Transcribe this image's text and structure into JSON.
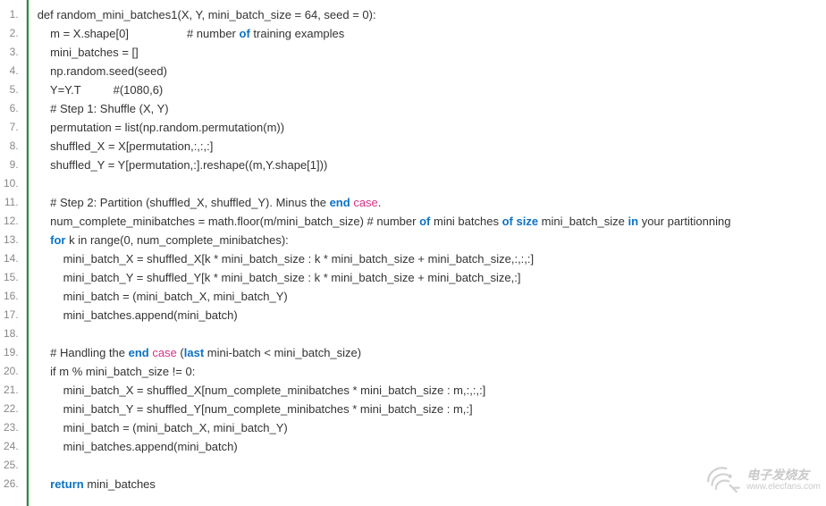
{
  "watermark": {
    "cn": "电子发烧友",
    "en": "www.elecfans.com"
  },
  "lines": [
    {
      "num": "1.",
      "segs": [
        {
          "t": "def random_mini_batches1(X, Y, mini_batch_size = 64, seed = 0):"
        }
      ],
      "indent": 0
    },
    {
      "num": "2.",
      "segs": [
        {
          "t": "m = X.shape[0]                  # number "
        },
        {
          "t": "of",
          "c": "kw-blue"
        },
        {
          "t": " training examples"
        }
      ],
      "indent": 1
    },
    {
      "num": "3.",
      "segs": [
        {
          "t": "mini_batches = []"
        }
      ],
      "indent": 1
    },
    {
      "num": "4.",
      "segs": [
        {
          "t": "np.random.seed(seed)"
        }
      ],
      "indent": 1
    },
    {
      "num": "5.",
      "segs": [
        {
          "t": "Y=Y.T          #(1080,6)"
        }
      ],
      "indent": 1
    },
    {
      "num": "6.",
      "segs": [
        {
          "t": "# Step 1: Shuffle (X, Y)"
        }
      ],
      "indent": 1
    },
    {
      "num": "7.",
      "segs": [
        {
          "t": "permutation = list(np.random.permutation(m))"
        }
      ],
      "indent": 1
    },
    {
      "num": "8.",
      "segs": [
        {
          "t": "shuffled_X = X[permutation,:,:,:]"
        }
      ],
      "indent": 1
    },
    {
      "num": "9.",
      "segs": [
        {
          "t": "shuffled_Y = Y[permutation,:].reshape((m,Y.shape[1]))"
        }
      ],
      "indent": 1
    },
    {
      "num": "10.",
      "segs": [
        {
          "t": ""
        }
      ],
      "indent": 0
    },
    {
      "num": "11.",
      "segs": [
        {
          "t": "# Step 2: Partition (shuffled_X, shuffled_Y). Minus the "
        },
        {
          "t": "end",
          "c": "kw-blue"
        },
        {
          "t": " "
        },
        {
          "t": "case",
          "c": "kw-pink"
        },
        {
          "t": "."
        }
      ],
      "indent": 1
    },
    {
      "num": "12.",
      "segs": [
        {
          "t": "num_complete_minibatches = math.floor(m/mini_batch_size) # number "
        },
        {
          "t": "of",
          "c": "kw-blue"
        },
        {
          "t": " mini batches "
        },
        {
          "t": "of",
          "c": "kw-blue"
        },
        {
          "t": " "
        },
        {
          "t": "size",
          "c": "kw-blue"
        },
        {
          "t": " mini_batch_size "
        },
        {
          "t": "in",
          "c": "kw-blue"
        },
        {
          "t": " your partitionning"
        }
      ],
      "indent": 1
    },
    {
      "num": "13.",
      "segs": [
        {
          "t": "for",
          "c": "kw-blue"
        },
        {
          "t": " k in range(0, num_complete_minibatches):"
        }
      ],
      "indent": 1
    },
    {
      "num": "14.",
      "segs": [
        {
          "t": "mini_batch_X = shuffled_X[k * mini_batch_size : k * mini_batch_size + mini_batch_size,:,:,:]"
        }
      ],
      "indent": 2
    },
    {
      "num": "15.",
      "segs": [
        {
          "t": "mini_batch_Y = shuffled_Y[k * mini_batch_size : k * mini_batch_size + mini_batch_size,:]"
        }
      ],
      "indent": 2
    },
    {
      "num": "16.",
      "segs": [
        {
          "t": "mini_batch = (mini_batch_X, mini_batch_Y)"
        }
      ],
      "indent": 2
    },
    {
      "num": "17.",
      "segs": [
        {
          "t": "mini_batches.append(mini_batch)"
        }
      ],
      "indent": 2
    },
    {
      "num": "18.",
      "segs": [
        {
          "t": ""
        }
      ],
      "indent": 0
    },
    {
      "num": "19.",
      "segs": [
        {
          "t": "# Handling the "
        },
        {
          "t": "end",
          "c": "kw-blue"
        },
        {
          "t": " "
        },
        {
          "t": "case",
          "c": "kw-pink"
        },
        {
          "t": " ("
        },
        {
          "t": "last",
          "c": "kw-blue"
        },
        {
          "t": " mini-batch < mini_batch_size)"
        }
      ],
      "indent": 1
    },
    {
      "num": "20.",
      "segs": [
        {
          "t": "if m % mini_batch_size != 0:"
        }
      ],
      "indent": 1
    },
    {
      "num": "21.",
      "segs": [
        {
          "t": "mini_batch_X = shuffled_X[num_complete_minibatches * mini_batch_size : m,:,:,:]"
        }
      ],
      "indent": 2
    },
    {
      "num": "22.",
      "segs": [
        {
          "t": "mini_batch_Y = shuffled_Y[num_complete_minibatches * mini_batch_size : m,:]"
        }
      ],
      "indent": 2
    },
    {
      "num": "23.",
      "segs": [
        {
          "t": "mini_batch = (mini_batch_X, mini_batch_Y)"
        }
      ],
      "indent": 2
    },
    {
      "num": "24.",
      "segs": [
        {
          "t": "mini_batches.append(mini_batch)"
        }
      ],
      "indent": 2
    },
    {
      "num": "25.",
      "segs": [
        {
          "t": ""
        }
      ],
      "indent": 0
    },
    {
      "num": "26.",
      "segs": [
        {
          "t": "return",
          "c": "kw-blue"
        },
        {
          "t": " mini_batches"
        }
      ],
      "indent": 1
    }
  ]
}
